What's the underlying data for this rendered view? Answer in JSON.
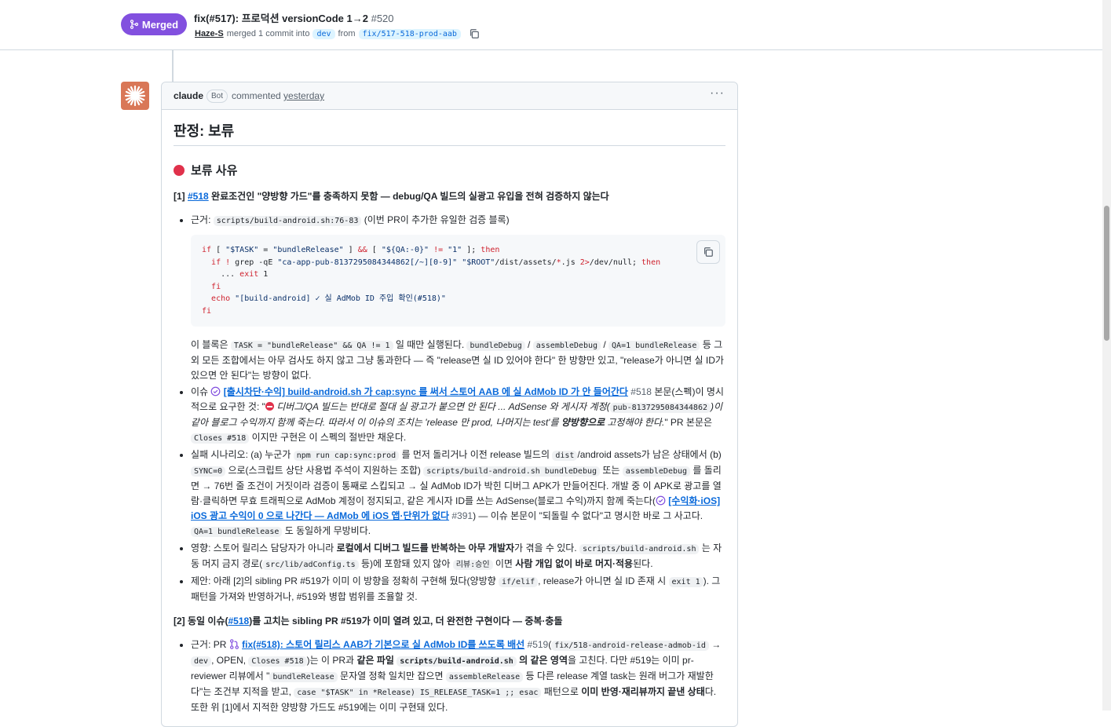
{
  "header": {
    "status_label": "Merged",
    "title": "fix(#517): 프로덕션 versionCode 1→2",
    "number": "#520",
    "author": "Haze-S",
    "merged_text": "merged 1 commit into",
    "base_branch": "dev",
    "from_text": "from",
    "head_branch": "fix/517-518-prod-aab"
  },
  "comment": {
    "author": "claude",
    "badge": "Bot",
    "action": "commented",
    "when": "yesterday",
    "menu": "···",
    "verdict": "판정: 보류",
    "hold_heading": "보류 사유",
    "section1": {
      "prefix": "[1] ",
      "ref": "#518",
      "text": " 완료조건인 \"양방향 가드\"를 충족하지 못함 — debug/QA 빌드의 실광고 유입을 전혀 검증하지 않는다"
    },
    "b1": {
      "label": "근거: ",
      "code": "scripts/build-android.sh:76-83",
      "after": " (이번 PR이 추가한 유일한 검증 블록)"
    },
    "code_lines": [
      "if [ \"$TASK\" = \"bundleRelease\" ] && [ \"${QA:-0}\" != \"1\" ]; then",
      "  if ! grep -qE \"ca-app-pub-8137295084344862[/~][0-9]\" \"$ROOT\"/dist/assets/*.js 2>/dev/null; then",
      "    ... exit 1",
      "  fi",
      "  echo \"[build-android] ✓ 실 AdMob ID 주입 확인(#518)\"",
      "fi"
    ],
    "p1": {
      "a": "이 블록은 ",
      "c1": "TASK = \"bundleRelease\" && QA != 1",
      "b": " 일 때만 실행된다. ",
      "c2": "bundleDebug",
      "c": " / ",
      "c3": "assembleDebug",
      "d": " / ",
      "c4": "QA=1 bundleRelease",
      "e": " 등 그 외 모든 조합에서는 아무 검사도 하지 않고 그냥 통과한다 — 즉 \"release면 실 ID 있어야 한다\" 한 방향만 있고, \"release가 아니면 실 ID가 있으면 안 된다\"는 방향이 없다."
    },
    "b2": {
      "label": "이슈 ",
      "link": "[출시차단·수익] build-android.sh 가 cap:sync 를 써서 스토어 AAB 에 실 AdMob ID 가 안 들어간다",
      "num": " #518",
      "a": " 본문(스펙)이 명시적으로 요구한 것: \"",
      "quote1": " 디버그/QA 빌드는 반대로 절대 실 광고가 붙으면 안 된다 ... AdSense 와 게시자 계정(",
      "code": "pub-8137295084344862",
      "quote2": ")이 같아 블로그 수익까지 함께 죽는다. 따라서 이 이슈의 조치는 'release 만 prod, 나머지는 test'를 ",
      "strong": "양방향으로",
      "quote3": " 고정해야 한다.",
      "b": "\" PR 본문은 ",
      "code2": "Closes #518",
      "c": " 이지만 구현은 이 스펙의 절반만 채운다."
    },
    "b3": {
      "a": "실패 시나리오: (a) 누군가 ",
      "c1": "npm run cap:sync:prod",
      "b": " 를 먼저 돌리거나 이전 release 빌드의 ",
      "c2": "dist",
      "c": "/android assets가 남은 상태에서 (b) ",
      "c3": "SYNC=0",
      "d": " 으로(스크립트 상단 사용법 주석이 지원하는 조합) ",
      "c4": "scripts/build-android.sh bundleDebug",
      "e": " 또는 ",
      "c5": "assembleDebug",
      "f": " 를 돌리면 → 76번 줄 조건이 거짓이라 검증이 통째로 스킵되고 → 실 AdMob ID가 박힌 디버그 APK가 만들어진다. 개발 중 이 APK로 광고를 열람·클릭하면 무효 트래픽으로 AdMob 계정이 정지되고, 같은 게시자 ID를 쓰는 AdSense(블로그 수익)까지 함께 죽는다(",
      "link": "[수익화·iOS] iOS 광고 수익이 0 으로 나간다 — AdMob 에 iOS 앱·단위가 없다",
      "num": " #391",
      "g": ") — 이슈 본문이 \"되돌릴 수 없다\"고 명시한 바로 그 사고다. ",
      "c6": "QA=1 bundleRelease",
      "h": " 도 동일하게 무방비다."
    },
    "b4": {
      "a": "영향: 스토어 릴리스 담당자가 아니라 ",
      "s1": "로컬에서 디버그 빌드를 반복하는 아무 개발자",
      "b": "가 겪을 수 있다. ",
      "c1": "scripts/build-android.sh",
      "c": " 는 자동 머지 금지 경로(",
      "c2": "src/lib/adConfig.ts",
      "d": " 등)에 포함돼 있지 않아 ",
      "c3": "리뷰:승인",
      "e": " 이면 ",
      "s2": "사람 개입 없이 바로 머지·적용",
      "f": "된다."
    },
    "b5": {
      "a": "제안: 아래 [2]의 sibling PR #519가 이미 이 방향을 정확히 구현해 뒀다(양방향 ",
      "c1": "if/elif",
      "b": ", release가 아니면 실 ID 존재 시 ",
      "c2": "exit 1",
      "c": "). 그 패턴을 가져와 반영하거나, #519와 병합 범위를 조율할 것."
    },
    "section2": {
      "a": "[2] 동일 이슈(",
      "ref": "#518",
      "b": ")를 고치는 sibling PR #519가 이미 열려 있고, 더 완전한 구현이다 — 중복·충돌"
    },
    "b6": {
      "label": "근거: PR ",
      "link": "fix(#518): 스토어 릴리스 AAB가 기본으로 실 AdMob ID를 쓰도록 배선",
      "num": " #519",
      "a": "(",
      "c1": "fix/518-android-release-admob-id",
      "b": " → ",
      "c2": "dev",
      "c": ", OPEN, ",
      "c3": "Closes #518",
      "d": ")는 이 PR과 ",
      "s1": "같은 파일 ",
      "c4": "scripts/build-android.sh",
      "s2": " 의 같은 영역",
      "e": "을 고친다. 다만 #519는 이미 pr-reviewer 리뷰에서 \"",
      "c5": "bundleRelease",
      "f": " 문자열 정확 일치만 잡으면 ",
      "c6": "assembleRelease",
      "g": " 등 다른 release 계열 task는 원래 버그가 재발한다\"는 조건부 지적을 받고, ",
      "c7": "case \"$TASK\" in *Release) IS_RELEASE_TASK=1 ;; esac",
      "h": " 패턴으로 ",
      "s3": "이미 반영·재리뷰까지 끝낸 상태",
      "i": "다. 또한 위 [1]에서 지적한 양방향 가드도 #519에는 이미 구현돼 있다."
    }
  },
  "colors": {
    "merged_purple": "#8250df",
    "link_blue": "#0969da",
    "stop_red": "#e0314b",
    "avatar_orange": "#d97757"
  },
  "icons": [
    "merge-icon",
    "copy-icon",
    "claude-logo-icon",
    "red-circle-icon",
    "check-circle-icon",
    "stop-icon",
    "pull-request-icon",
    "kebab-menu-icon"
  ]
}
